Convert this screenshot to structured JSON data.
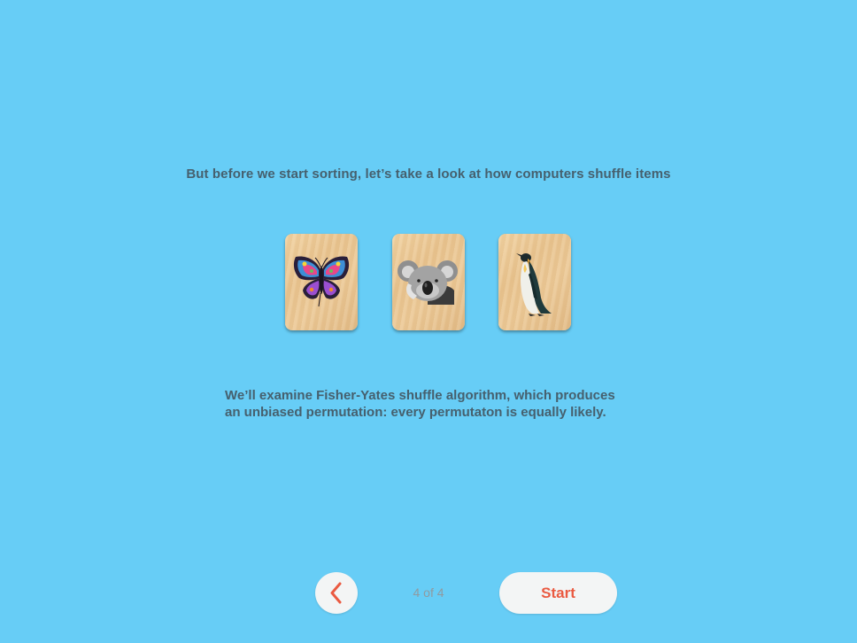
{
  "intro_text": "But before we start sorting, let’s take a look at how computers shuffle items",
  "cards": [
    {
      "animal": "butterfly",
      "icon": "butterfly-icon"
    },
    {
      "animal": "koala",
      "icon": "koala-icon"
    },
    {
      "animal": "penguin",
      "icon": "penguin-icon"
    }
  ],
  "explanation": {
    "line1": "We’ll examine Fisher-Yates shuffle algorithm, which produces",
    "line2": "an unbiased permutation: every permutaton is equally likely."
  },
  "navigation": {
    "back_icon": "chevron-left-icon",
    "page_indicator": "4 of 4",
    "start_label": "Start"
  },
  "colors": {
    "background": "#67cdf6",
    "text": "#46606e",
    "accent": "#ea5a41",
    "button_bg": "#f3f5f5"
  }
}
